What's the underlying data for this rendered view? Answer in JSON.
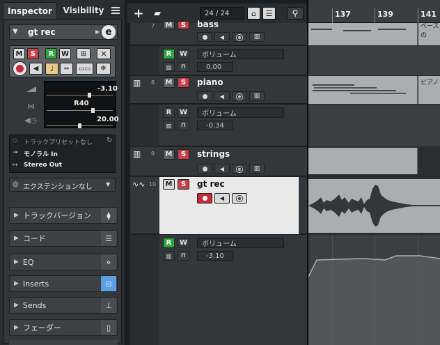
{
  "inspector": {
    "tab_inspector": "Inspector",
    "tab_visibility": "Visibility",
    "menu_icon": "hamburger-icon",
    "track_name": "gt rec",
    "edit_icon": "e",
    "btn_m": "M",
    "btn_s": "S",
    "btn_r": "R",
    "btn_w": "W",
    "volume_value": "-3.10",
    "pan_value": "R40",
    "delay_value": "20.00",
    "preset": "トラックプリセットなし",
    "input": "モノラル In",
    "output": "Stereo Out",
    "extension": "エクステンションなし",
    "sections": [
      {
        "label": "トラックバージョン",
        "icon": "versions-icon"
      },
      {
        "label": "コード",
        "icon": "chord-icon"
      },
      {
        "label": "EQ",
        "icon": "eq-icon"
      },
      {
        "label": "Inserts",
        "icon": "inserts-icon"
      },
      {
        "label": "Sends",
        "icon": "sends-icon"
      },
      {
        "label": "フェーダー",
        "icon": "fader-icon"
      }
    ]
  },
  "toolbar": {
    "add_icon": "plus-icon",
    "folder_icon": "add-folder-icon",
    "track_count": "24 / 24",
    "search_icon": "search-icon"
  },
  "ruler": {
    "bars": [
      "137",
      "139",
      "141"
    ]
  },
  "tracks": [
    {
      "number": "7",
      "name": "bass",
      "auto_label": "ボリューム",
      "auto_value": "0.00"
    },
    {
      "number": "8",
      "name": "piano",
      "auto_label": "ボリューム",
      "auto_value": "-0.34"
    },
    {
      "number": "9",
      "name": "strings"
    },
    {
      "number": "10",
      "name": "gt rec",
      "auto_label": "ボリューム",
      "auto_value": "-3.10"
    }
  ],
  "events": {
    "bass_part": "ベースの",
    "piano_part": "ピアノ"
  },
  "colors": {
    "record_red": "#c8283a",
    "solo_red": "#c94046",
    "read_green": "#2da83f",
    "accent_blue": "#5aa0e6",
    "part_gray": "#aaaeb2"
  }
}
